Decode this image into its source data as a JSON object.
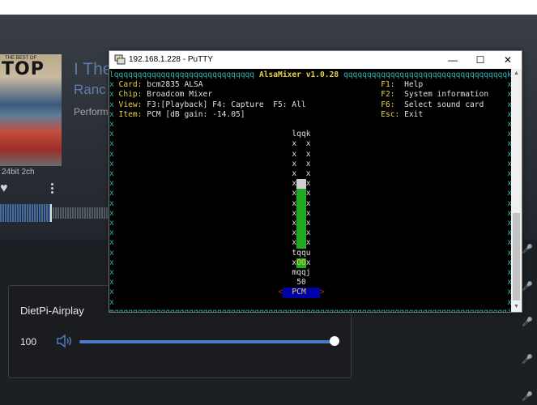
{
  "background_app": {
    "album_art_text": "TOP",
    "album_art_small": "THE BEST OF",
    "track_title": "I The",
    "track_artist": "Ranc",
    "track_performer": "Perform",
    "audio_info": "24bit 2ch",
    "airplay_panel": {
      "title": "DietPi-Airplay",
      "volume_value": "100",
      "volume_fraction": 1.0
    },
    "accent_color": "#4c7bc3"
  },
  "putty": {
    "window_title": "192.168.1.228 - PuTTY",
    "controls": {
      "minimize": "—",
      "maximize": "☐",
      "close": "✕"
    },
    "terminal": {
      "header_title": "AlsaMixer v1.0.28",
      "header_fill_char": "q",
      "border_char": "x",
      "info_lines": [
        {
          "label": "Card:",
          "value": "bcm2835 ALSA"
        },
        {
          "label": "Chip:",
          "value": "Broadcom Mixer"
        },
        {
          "label": "View:",
          "value": "F3:[Playback] F4: Capture  F5: All"
        },
        {
          "label": "Item:",
          "value": "PCM [dB gain: -14.05]"
        }
      ],
      "keys": [
        {
          "key": "F1:",
          "action": "Help"
        },
        {
          "key": "F2:",
          "action": "System information"
        },
        {
          "key": "F6:",
          "action": "Select sound card"
        },
        {
          "key": "Esc:",
          "action": "Exit"
        }
      ],
      "channel": {
        "name": "PCM",
        "value": "50",
        "fader_top": "lqqk",
        "fader_bottom": "mqqj",
        "fader_mid": "tqqu",
        "mute_indicator": "OO",
        "level_fill_char": "aa"
      }
    }
  }
}
